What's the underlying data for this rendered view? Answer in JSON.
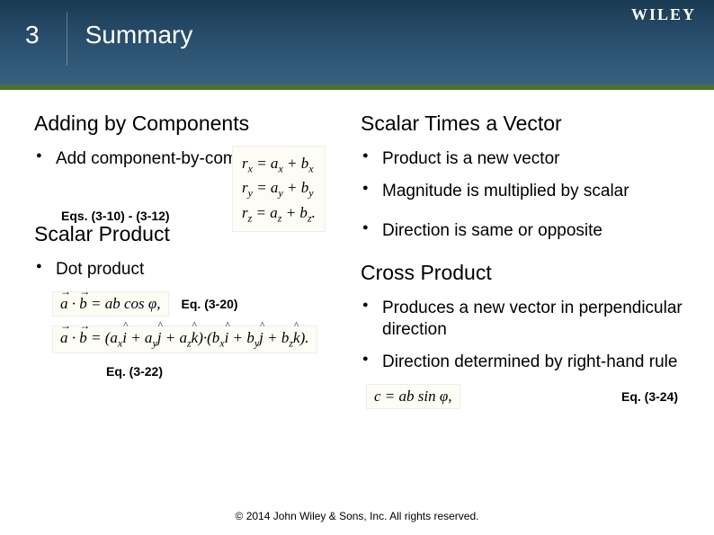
{
  "header": {
    "slide_number": "3",
    "title": "Summary",
    "brand": "WILEY"
  },
  "sections": {
    "adding": {
      "title": "Adding by Components",
      "bullet1": "Add component-by-component",
      "eq_label": "Eqs. (3-10) - (3-12)",
      "formula_rx": "rₓ = aₓ + bₓ",
      "formula_ry": "rᵧ = aᵧ + bᵧ",
      "formula_rz": "r_z = a_z + b_z."
    },
    "scalar_times": {
      "title": "Scalar Times a Vector",
      "b1": "Product is a new vector",
      "b2": "Magnitude is multiplied by scalar",
      "b3": "Direction is same or opposite"
    },
    "scalar_product": {
      "title": "Scalar Product",
      "b1": "Dot product",
      "eq20": "Eq. (3-20)",
      "eq22": "Eq. (3-22)",
      "formula1": "a·b = ab cos φ,",
      "formula2": "a·b = (aₓî + aᵧĵ + a_zk̂)·(bₓî + bᵧĵ + b_zk̂)."
    },
    "cross_product": {
      "title": "Cross Product",
      "b1": "Produces a new vector in perpendicular direction",
      "b2": "Direction determined by right-hand rule",
      "eq24": "Eq. (3-24)",
      "formula": "c = ab sin φ,"
    }
  },
  "footer": "© 2014 John Wiley & Sons, Inc. All rights reserved."
}
